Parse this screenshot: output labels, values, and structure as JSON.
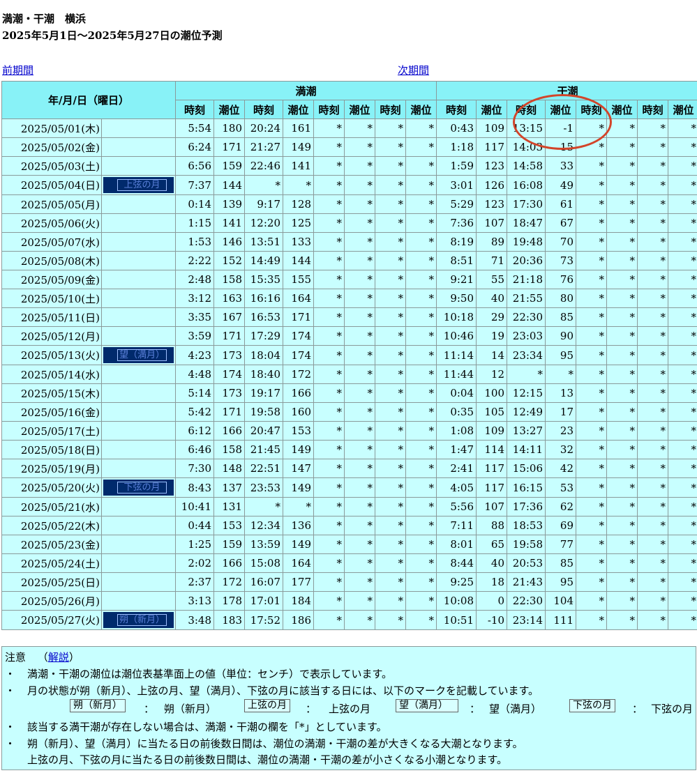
{
  "title": "満潮・干潮　横浜",
  "subtitle": "2025年5月1日〜2025年5月27日の潮位予測",
  "nav": {
    "prev": "前期間",
    "next": "次期間"
  },
  "headers": {
    "date": "年/月/日（曜日）",
    "high": "満潮",
    "low": "干潮",
    "time": "時刻",
    "level": "潮位"
  },
  "rows": [
    {
      "date": "2025/05/01(木)",
      "moon": "",
      "h": [
        "5:54",
        "180",
        "20:24",
        "161"
      ],
      "l": [
        "0:43",
        "109",
        "13:15",
        "-1"
      ]
    },
    {
      "date": "2025/05/02(金)",
      "moon": "",
      "h": [
        "6:24",
        "171",
        "21:27",
        "149"
      ],
      "l": [
        "1:18",
        "117",
        "14:03",
        "15"
      ]
    },
    {
      "date": "2025/05/03(土)",
      "moon": "",
      "h": [
        "6:56",
        "159",
        "22:46",
        "141"
      ],
      "l": [
        "1:59",
        "123",
        "14:58",
        "33"
      ]
    },
    {
      "date": "2025/05/04(日)",
      "moon": "上弦の月",
      "h": [
        "7:37",
        "144",
        "*",
        "*"
      ],
      "l": [
        "3:01",
        "126",
        "16:08",
        "49"
      ]
    },
    {
      "date": "2025/05/05(月)",
      "moon": "",
      "h": [
        "0:14",
        "139",
        "9:17",
        "128"
      ],
      "l": [
        "5:29",
        "123",
        "17:30",
        "61"
      ]
    },
    {
      "date": "2025/05/06(火)",
      "moon": "",
      "h": [
        "1:15",
        "141",
        "12:20",
        "125"
      ],
      "l": [
        "7:36",
        "107",
        "18:47",
        "67"
      ]
    },
    {
      "date": "2025/05/07(水)",
      "moon": "",
      "h": [
        "1:53",
        "146",
        "13:51",
        "133"
      ],
      "l": [
        "8:19",
        "89",
        "19:48",
        "70"
      ]
    },
    {
      "date": "2025/05/08(木)",
      "moon": "",
      "h": [
        "2:22",
        "152",
        "14:49",
        "144"
      ],
      "l": [
        "8:51",
        "71",
        "20:36",
        "73"
      ]
    },
    {
      "date": "2025/05/09(金)",
      "moon": "",
      "h": [
        "2:48",
        "158",
        "15:35",
        "155"
      ],
      "l": [
        "9:21",
        "55",
        "21:18",
        "76"
      ]
    },
    {
      "date": "2025/05/10(土)",
      "moon": "",
      "h": [
        "3:12",
        "163",
        "16:16",
        "164"
      ],
      "l": [
        "9:50",
        "40",
        "21:55",
        "80"
      ]
    },
    {
      "date": "2025/05/11(日)",
      "moon": "",
      "h": [
        "3:35",
        "167",
        "16:53",
        "171"
      ],
      "l": [
        "10:18",
        "29",
        "22:30",
        "85"
      ]
    },
    {
      "date": "2025/05/12(月)",
      "moon": "",
      "h": [
        "3:59",
        "171",
        "17:29",
        "174"
      ],
      "l": [
        "10:46",
        "19",
        "23:03",
        "90"
      ]
    },
    {
      "date": "2025/05/13(火)",
      "moon": "望（満月）",
      "h": [
        "4:23",
        "173",
        "18:04",
        "174"
      ],
      "l": [
        "11:14",
        "14",
        "23:34",
        "95"
      ]
    },
    {
      "date": "2025/05/14(水)",
      "moon": "",
      "h": [
        "4:48",
        "174",
        "18:40",
        "172"
      ],
      "l": [
        "11:44",
        "12",
        "*",
        "*"
      ]
    },
    {
      "date": "2025/05/15(木)",
      "moon": "",
      "h": [
        "5:14",
        "173",
        "19:17",
        "166"
      ],
      "l": [
        "0:04",
        "100",
        "12:15",
        "13"
      ]
    },
    {
      "date": "2025/05/16(金)",
      "moon": "",
      "h": [
        "5:42",
        "171",
        "19:58",
        "160"
      ],
      "l": [
        "0:35",
        "105",
        "12:49",
        "17"
      ]
    },
    {
      "date": "2025/05/17(土)",
      "moon": "",
      "h": [
        "6:12",
        "166",
        "20:47",
        "153"
      ],
      "l": [
        "1:08",
        "109",
        "13:27",
        "23"
      ]
    },
    {
      "date": "2025/05/18(日)",
      "moon": "",
      "h": [
        "6:46",
        "158",
        "21:45",
        "149"
      ],
      "l": [
        "1:47",
        "114",
        "14:11",
        "32"
      ]
    },
    {
      "date": "2025/05/19(月)",
      "moon": "",
      "h": [
        "7:30",
        "148",
        "22:51",
        "147"
      ],
      "l": [
        "2:41",
        "117",
        "15:06",
        "42"
      ]
    },
    {
      "date": "2025/05/20(火)",
      "moon": "下弦の月",
      "h": [
        "8:43",
        "137",
        "23:53",
        "149"
      ],
      "l": [
        "4:05",
        "117",
        "16:15",
        "53"
      ]
    },
    {
      "date": "2025/05/21(水)",
      "moon": "",
      "h": [
        "10:41",
        "131",
        "*",
        "*"
      ],
      "l": [
        "5:56",
        "107",
        "17:36",
        "62"
      ]
    },
    {
      "date": "2025/05/22(木)",
      "moon": "",
      "h": [
        "0:44",
        "153",
        "12:34",
        "136"
      ],
      "l": [
        "7:11",
        "88",
        "18:53",
        "69"
      ]
    },
    {
      "date": "2025/05/23(金)",
      "moon": "",
      "h": [
        "1:25",
        "159",
        "13:59",
        "149"
      ],
      "l": [
        "8:01",
        "65",
        "19:58",
        "77"
      ]
    },
    {
      "date": "2025/05/24(土)",
      "moon": "",
      "h": [
        "2:02",
        "166",
        "15:08",
        "164"
      ],
      "l": [
        "8:44",
        "40",
        "20:53",
        "85"
      ]
    },
    {
      "date": "2025/05/25(日)",
      "moon": "",
      "h": [
        "2:37",
        "172",
        "16:07",
        "177"
      ],
      "l": [
        "9:25",
        "18",
        "21:43",
        "95"
      ]
    },
    {
      "date": "2025/05/26(月)",
      "moon": "",
      "h": [
        "3:13",
        "178",
        "17:01",
        "184"
      ],
      "l": [
        "10:08",
        "0",
        "22:30",
        "104"
      ]
    },
    {
      "date": "2025/05/27(火)",
      "moon": "朔（新月）",
      "h": [
        "3:48",
        "183",
        "17:52",
        "186"
      ],
      "l": [
        "10:51",
        "-10",
        "23:14",
        "111"
      ]
    }
  ],
  "empty_mark": "*",
  "notes": {
    "label": "注意",
    "link": "解説",
    "bullet": "・",
    "line1": "満潮・干潮の潮位は潮位表基準面上の値（単位：センチ）で表示しています。",
    "line2": "月の状態が朔（新月）、上弦の月、望（満月）、下弦の月に該当する日には、以下のマークを記載しています。",
    "legend": [
      {
        "mark": "朔（新月）",
        "name": "朔（新月）"
      },
      {
        "mark": "上弦の月",
        "name": "上弦の月"
      },
      {
        "mark": "望（満月）",
        "name": "望（満月）"
      },
      {
        "mark": "下弦の月",
        "name": "下弦の月"
      }
    ],
    "colon": "：",
    "line3": "該当する満干潮が存在しない場合は、満潮・干潮の欄を「*」としています。",
    "line4": "朔（新月）、望（満月）に当たる日の前後数日間は、潮位の満潮・干潮の差が大きくなる大潮となります。",
    "line5": "上弦の月、下弦の月に当たる日の前後数日間は、潮位の満潮・干潮の差が小さくなる小潮となります。"
  },
  "colors": {
    "header_bg": "#88f2f7",
    "cell_bg": "#c8ffff",
    "moon_badge": "#002a6c",
    "annotation_circle": "#d2452a",
    "link": "#0000cc"
  }
}
